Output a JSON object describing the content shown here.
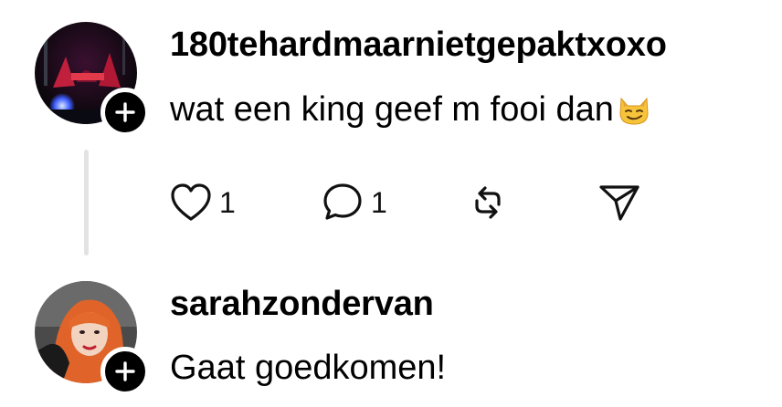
{
  "posts": [
    {
      "username": "180tehardmaarnietgepaktxoxo",
      "text": "wat een king geef m fooi dan",
      "emoji": "smirking-cat-emoji",
      "avatar": "avatar-car-night",
      "follow_icon": "plus-icon",
      "actions": {
        "like": {
          "icon": "heart-icon",
          "count": "1"
        },
        "reply": {
          "icon": "comment-bubble-icon",
          "count": "1"
        },
        "repost": {
          "icon": "repost-icon"
        },
        "share": {
          "icon": "send-icon"
        }
      }
    },
    {
      "username": "sarahzondervan",
      "text": "Gaat goedkomen!",
      "avatar": "avatar-red-hair-person",
      "follow_icon": "plus-icon"
    }
  ],
  "colors": {
    "text": "#000000",
    "thread_line": "#e3e3e3",
    "badge": "#000000",
    "background": "#ffffff"
  }
}
